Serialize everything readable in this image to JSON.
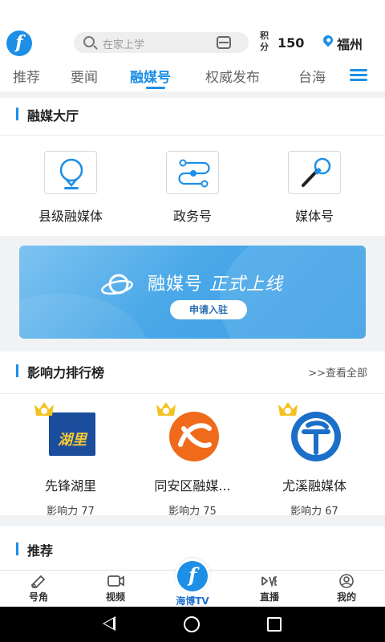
{
  "header": {
    "logo_letter": "f",
    "search_placeholder": "在家上学",
    "points_label": "积分",
    "points_value": "150",
    "location": "福州"
  },
  "tabs": [
    {
      "label": "推荐",
      "active": false
    },
    {
      "label": "要闻",
      "active": false
    },
    {
      "label": "融媒号",
      "active": true
    },
    {
      "label": "权威发布",
      "active": false
    },
    {
      "label": "台海",
      "active": false
    }
  ],
  "hall": {
    "title": "融媒大厅",
    "items": [
      {
        "label": "县级融媒体",
        "icon": "location-pin-icon"
      },
      {
        "label": "政务号",
        "icon": "route-icon"
      },
      {
        "label": "媒体号",
        "icon": "microphone-icon"
      }
    ]
  },
  "banner": {
    "title": "融媒号",
    "title_suffix": "正式上线",
    "button": "申请入驻"
  },
  "ranking": {
    "title": "影响力排行榜",
    "more": ">>查看全部",
    "items": [
      {
        "name": "先锋湖里",
        "score": "影响力 77",
        "logo_text": "湖里"
      },
      {
        "name": "同安区融媒...",
        "score": "影响力 75"
      },
      {
        "name": "尤溪融媒体",
        "score": "影响力 67"
      }
    ]
  },
  "recommend": {
    "title": "推荐"
  },
  "bottom_nav": {
    "items": [
      {
        "label": "号角"
      },
      {
        "label": "视频"
      },
      {
        "label": "海博TV"
      },
      {
        "label": "直播"
      },
      {
        "label": "我的"
      }
    ]
  },
  "colors": {
    "accent": "#1e8fe6"
  }
}
